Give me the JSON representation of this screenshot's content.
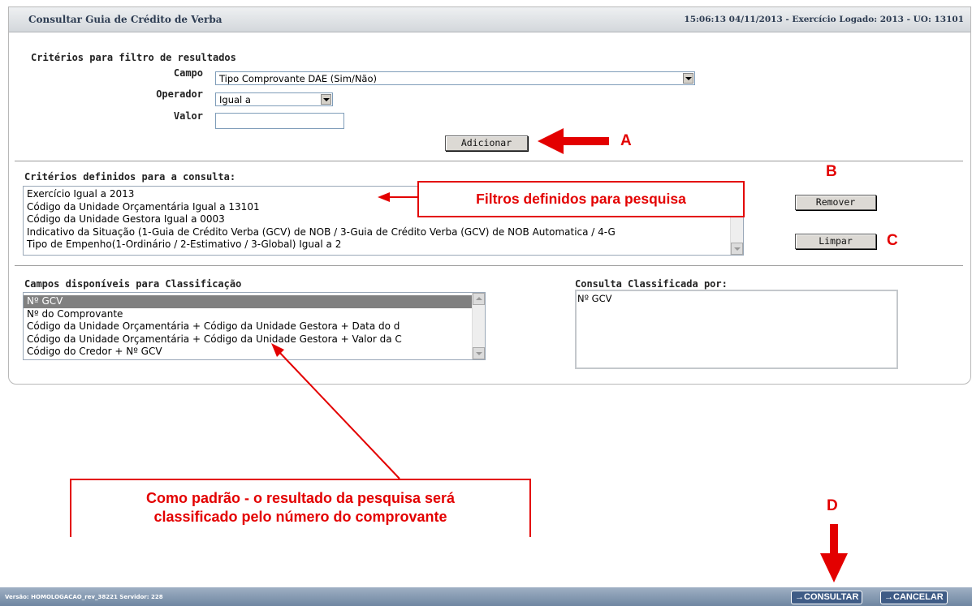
{
  "window": {
    "title": "Consultar Guia de Crédito de Verba",
    "status": "15:06:13 04/11/2013 - Exercício Logado: 2013 - UO: 13101"
  },
  "filter": {
    "heading": "Critérios para filtro de resultados",
    "campo_label": "Campo",
    "campo_value": "Tipo Comprovante DAE (Sim/Não)",
    "operador_label": "Operador",
    "operador_value": "Igual a",
    "valor_label": "Valor",
    "valor_value": "",
    "add_button": "Adicionar"
  },
  "criteria": {
    "heading": "Critérios definidos para a consulta:",
    "items": [
      "Exercício Igual a 2013",
      "Código da Unidade Orçamentária Igual a 13101",
      "Código da Unidade Gestora Igual a 0003",
      "Indicativo da Situação (1-Guia de Crédito Verba (GCV) de NOB / 3-Guia de Crédito Verba (GCV) de NOB Automatica / 4-G",
      "Tipo de Empenho(1-Ordinário / 2-Estimativo / 3-Global) Igual a 2"
    ],
    "remove_button": "Remover",
    "clear_button": "Limpar"
  },
  "sorting": {
    "available_heading": "Campos disponíveis para Classificação",
    "available_items": [
      "Nº GCV",
      "Nº do Comprovante",
      "Código da Unidade Orçamentária + Código da Unidade Gestora + Data do d",
      "Código da Unidade Orçamentária + Código da Unidade Gestora + Valor da C",
      "Código do Credor + Nº GCV"
    ],
    "selected_index": 0,
    "sorted_heading": "Consulta Classificada por:",
    "sorted_items": [
      "Nº GCV"
    ]
  },
  "annotations": {
    "A": "A",
    "B": "B",
    "C": "C",
    "D": "D",
    "filters_note": "Filtros definidos para pesquisa",
    "default_note_line1": "Como padrão - o resultado da pesquisa será",
    "default_note_line2": "classificado pelo número do comprovante",
    "color": "#e30000"
  },
  "footer": {
    "version": "Versão: HOMOLOGACAO_rev_38221  Servidor: 228",
    "consultar": "→CONSULTAR",
    "cancelar": "→CANCELAR"
  }
}
